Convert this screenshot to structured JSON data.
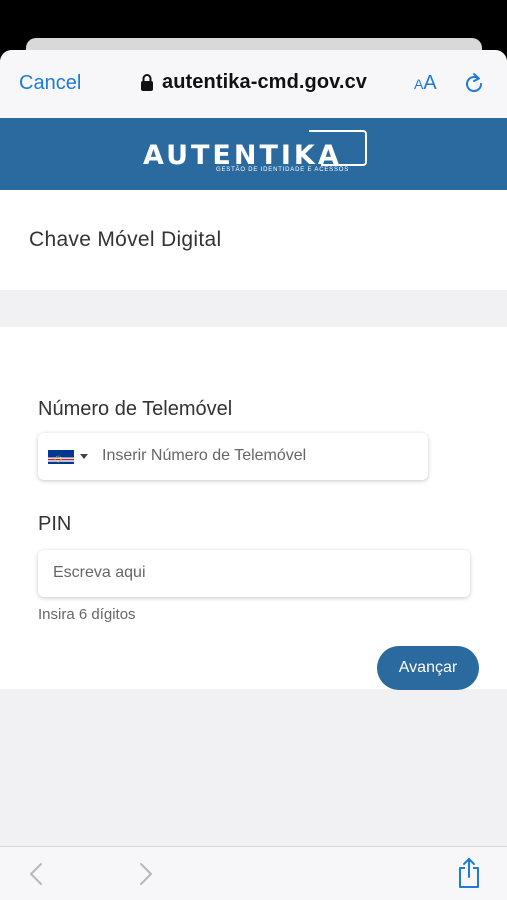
{
  "browser": {
    "cancel_label": "Cancel",
    "url": "autentika-cmd.gov.cv",
    "reader_label_big": "A",
    "reader_label_small": "A"
  },
  "brand": {
    "name": "AUTENTIKA",
    "tagline": "GESTÃO DE IDENTIDADE E ACESSOS",
    "color": "#2b6a9e"
  },
  "page": {
    "title": "Chave Móvel Digital"
  },
  "form": {
    "phone_label": "Número de Telemóvel",
    "phone_placeholder": "Inserir Número de Telemóvel",
    "pin_label": "PIN",
    "pin_placeholder": "Escreva aqui",
    "pin_hint": "Insira 6 dígitos",
    "submit_label": "Avançar",
    "country_flag": "cape-verde-flag-icon"
  },
  "accent_color": "#1e7bd9"
}
